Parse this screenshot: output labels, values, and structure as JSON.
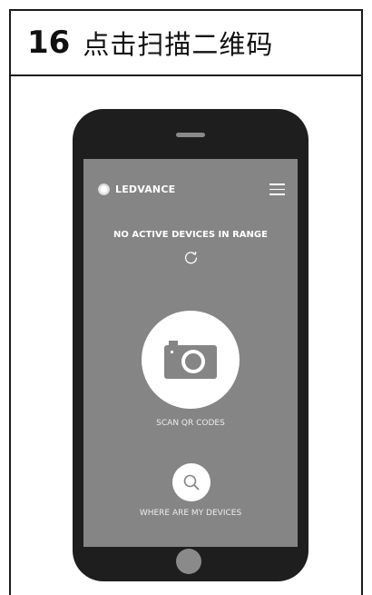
{
  "header": {
    "step_number": "16",
    "title": "点击扫描二维码"
  },
  "app": {
    "brand": "LEDVANCE",
    "status": "NO ACTIVE DEVICES IN RANGE",
    "scan_label": "SCAN QR CODES",
    "search_label": "WHERE ARE MY DEVICES"
  },
  "icons": {
    "logo": "ledvance-logo-dot",
    "menu": "hamburger-menu-icon",
    "refresh": "refresh-icon",
    "scan": "camera-icon",
    "search": "search-icon"
  },
  "colors": {
    "phone_body": "#1e1e1e",
    "screen": "#858585",
    "button": "#ffffff",
    "text": "#ffffff"
  }
}
